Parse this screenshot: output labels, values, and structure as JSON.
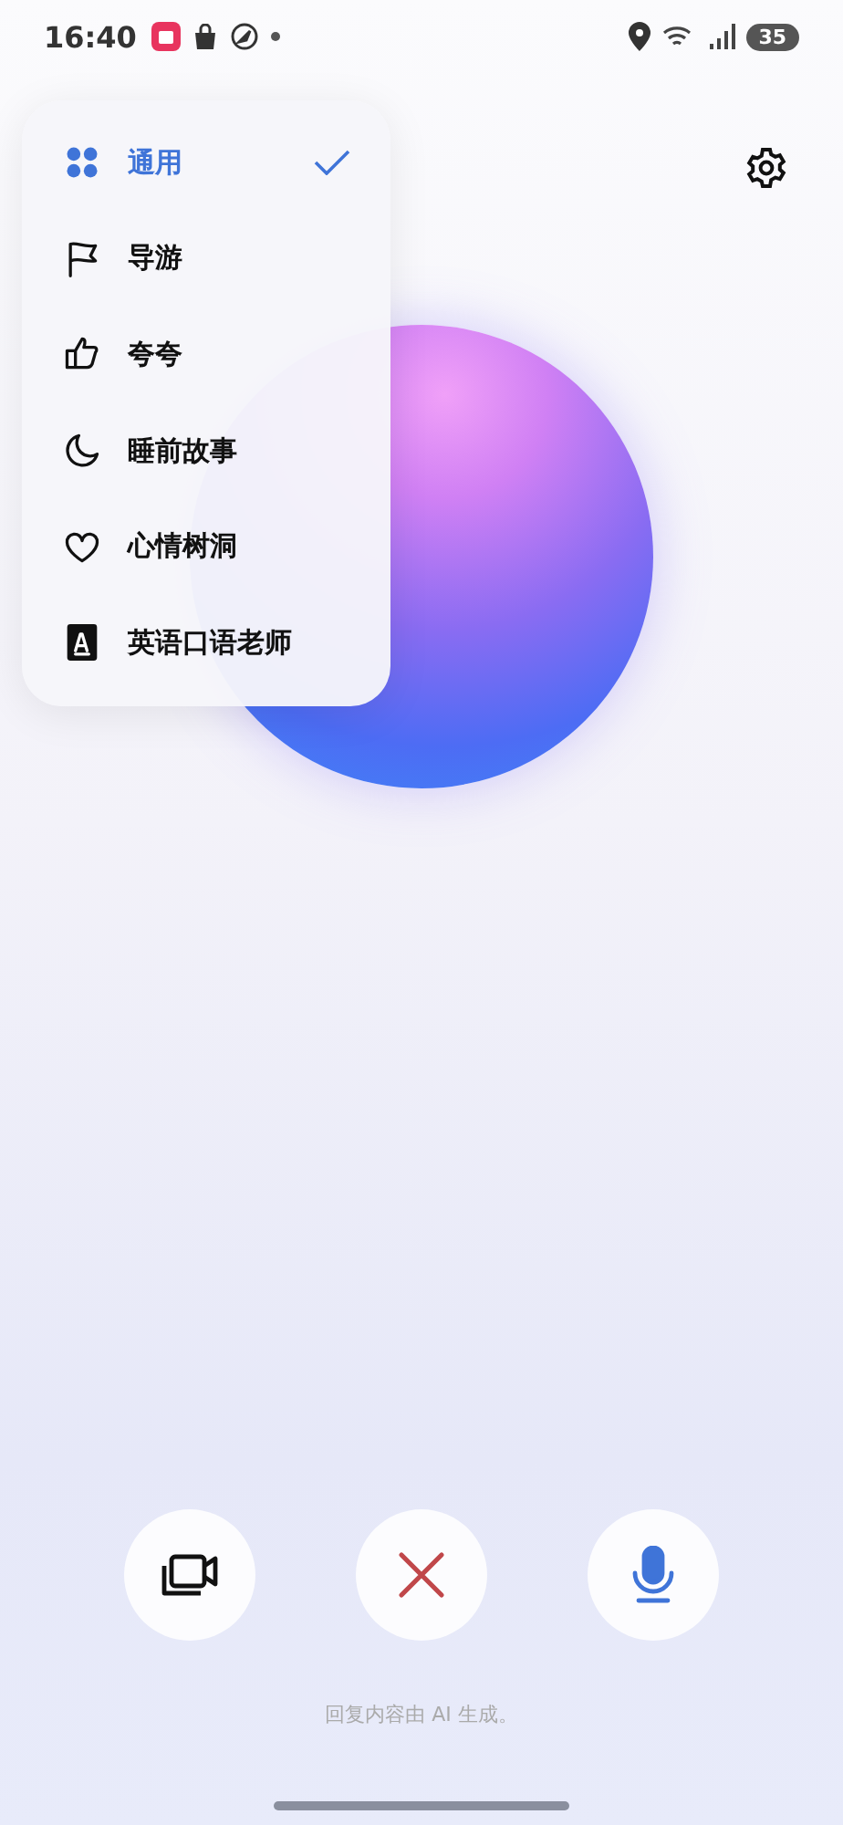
{
  "status_bar": {
    "time": "16:40",
    "battery": "35"
  },
  "mode_menu": {
    "items": [
      {
        "label": "通用",
        "kind": "grid",
        "selected": true
      },
      {
        "label": "导游",
        "kind": "flag",
        "selected": false
      },
      {
        "label": "夸夸",
        "kind": "thumb",
        "selected": false
      },
      {
        "label": "睡前故事",
        "kind": "moon",
        "selected": false
      },
      {
        "label": "心情树洞",
        "kind": "heart",
        "selected": false
      },
      {
        "label": "英语口语老师",
        "kind": "letter",
        "selected": false
      }
    ]
  },
  "controls": [
    {
      "kind": "camera"
    },
    {
      "kind": "close"
    },
    {
      "kind": "mic"
    }
  ],
  "footer": "回复内容由 AI 生成。"
}
